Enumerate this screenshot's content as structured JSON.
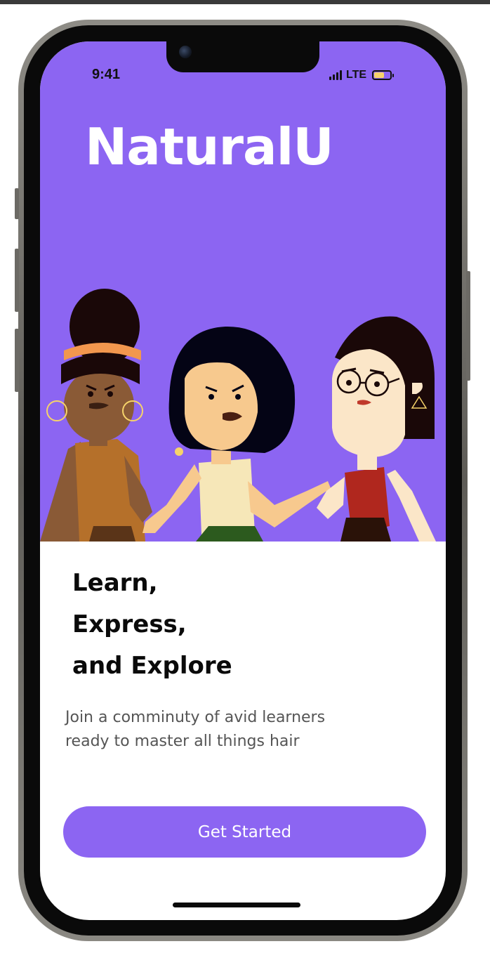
{
  "status_bar": {
    "time": "9:41",
    "network": "LTE",
    "signal_bars": 4,
    "battery_level": 0.6
  },
  "app": {
    "title": "NaturalU"
  },
  "onboarding": {
    "headline_lines": [
      "Learn,",
      "Express,",
      "and Explore"
    ],
    "subtitle_lines": [
      "Join a comminuty of avid learners",
      "ready to master all things hair"
    ],
    "cta_label": "Get Started"
  },
  "colors": {
    "brand_purple": "#8c65f2",
    "background": "#ffffff",
    "headline": "#0a0a0a",
    "subtitle": "#555555"
  },
  "icons": {
    "signal": "signal-bars-icon",
    "battery": "battery-icon"
  }
}
